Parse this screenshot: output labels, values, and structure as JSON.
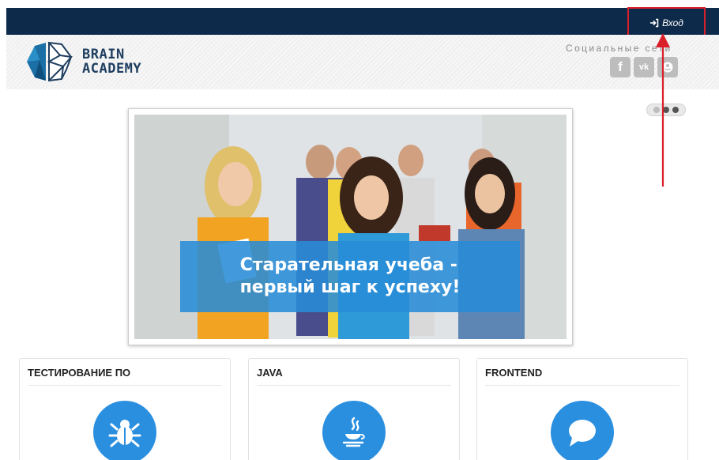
{
  "topbar": {
    "login_label": "Вход",
    "login_icon": "sign-in-icon"
  },
  "header": {
    "brand_line1": "BRAIN",
    "brand_line2": "ACADEMY",
    "social_title": "Социальные сети",
    "social_links": [
      {
        "icon": "facebook-icon",
        "label": "f"
      },
      {
        "icon": "vk-icon",
        "label": "vk"
      },
      {
        "icon": "odnoklassniki-icon",
        "label": ""
      }
    ]
  },
  "slider": {
    "slide_count": 3,
    "active_index": 0
  },
  "banner": {
    "slogan_line1": "Старательная учеба -",
    "slogan_line2": "первый шаг к успеху!"
  },
  "cards": [
    {
      "title": "ТЕСТИРОВАНИЕ ПО",
      "icon": "bug-icon"
    },
    {
      "title": "JAVA",
      "icon": "java-cup-icon"
    },
    {
      "title": "FRONTEND",
      "icon": "chat-bubble-icon"
    }
  ],
  "colors": {
    "topbar": "#0e2a4a",
    "accent_blue": "#2b8fe0",
    "highlight_red": "#d9202a"
  }
}
